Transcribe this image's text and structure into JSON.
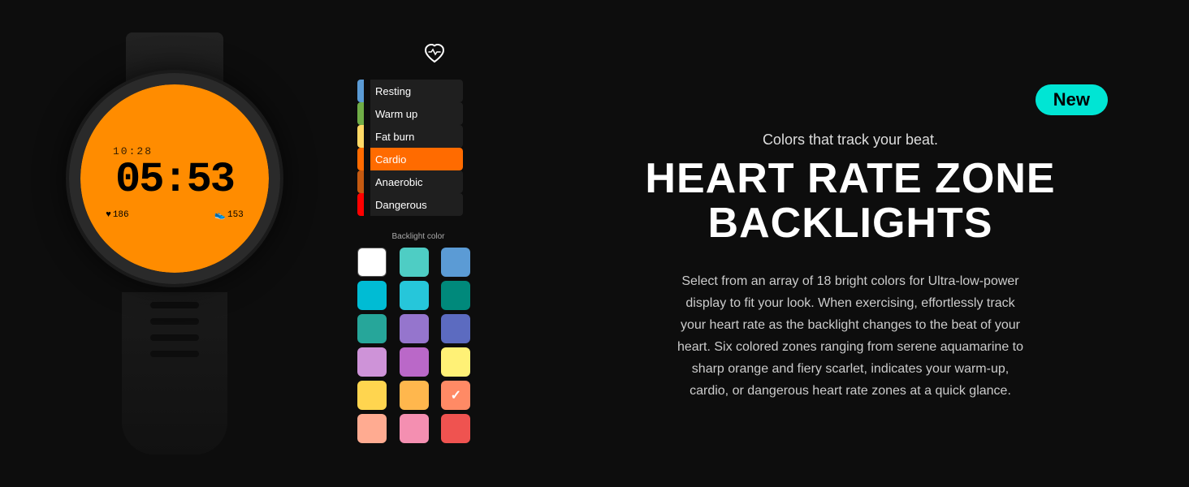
{
  "badge": {
    "label": "New"
  },
  "subtitle": "Colors that track your beat.",
  "main_title_line1": "HEART RATE ZONE",
  "main_title_line2": "BACKLIGHTS",
  "description": "Select from an array of 18 bright colors for Ultra-low-power display to fit your look. When exercising, effortlessly track your heart rate as the backlight changes to the beat of your heart. Six colored zones ranging from serene aquamarine to sharp orange and fiery scarlet, indicates your warm-up, cardio, or dangerous heart rate zones at a quick glance.",
  "watch": {
    "time_top": "10:28",
    "main_time": "05:53",
    "heart_rate": "186",
    "steps": "153"
  },
  "zones": [
    {
      "id": "resting",
      "label": "Resting",
      "color": "#5B9BD5",
      "active": false
    },
    {
      "id": "warmup",
      "label": "Warm up",
      "color": "#70AD47",
      "active": false
    },
    {
      "id": "fatburn",
      "label": "Fat burn",
      "color": "#FFD966",
      "active": false
    },
    {
      "id": "cardio",
      "label": "Cardio",
      "color": "#FF6B00",
      "active": true
    },
    {
      "id": "anaerobic",
      "label": "Anaerobic",
      "color": "#C55A11",
      "active": false
    },
    {
      "id": "dangerous",
      "label": "Dangerous",
      "color": "#FF0000",
      "active": false
    }
  ],
  "backlight_title": "Backlight color",
  "colors": [
    {
      "hex": "#FFFFFF",
      "selected": false
    },
    {
      "hex": "#4ECDC4",
      "selected": false
    },
    {
      "hex": "#5B9BD5",
      "selected": false
    },
    {
      "hex": "#00BCD4",
      "selected": false
    },
    {
      "hex": "#26C6DA",
      "selected": false
    },
    {
      "hex": "#00897B",
      "selected": false
    },
    {
      "hex": "#26A69A",
      "selected": false
    },
    {
      "hex": "#9575CD",
      "selected": false
    },
    {
      "hex": "#5C6BC0",
      "selected": false
    },
    {
      "hex": "#CE93D8",
      "selected": false
    },
    {
      "hex": "#BA68C8",
      "selected": false
    },
    {
      "hex": "#FFF176",
      "selected": false
    },
    {
      "hex": "#FFD54F",
      "selected": false
    },
    {
      "hex": "#FFB74D",
      "selected": false
    },
    {
      "hex": "#FF8A65",
      "selected": true
    },
    {
      "hex": "#FFAB91",
      "selected": false
    },
    {
      "hex": "#F48FB1",
      "selected": false
    },
    {
      "hex": "#EF5350",
      "selected": false
    }
  ]
}
